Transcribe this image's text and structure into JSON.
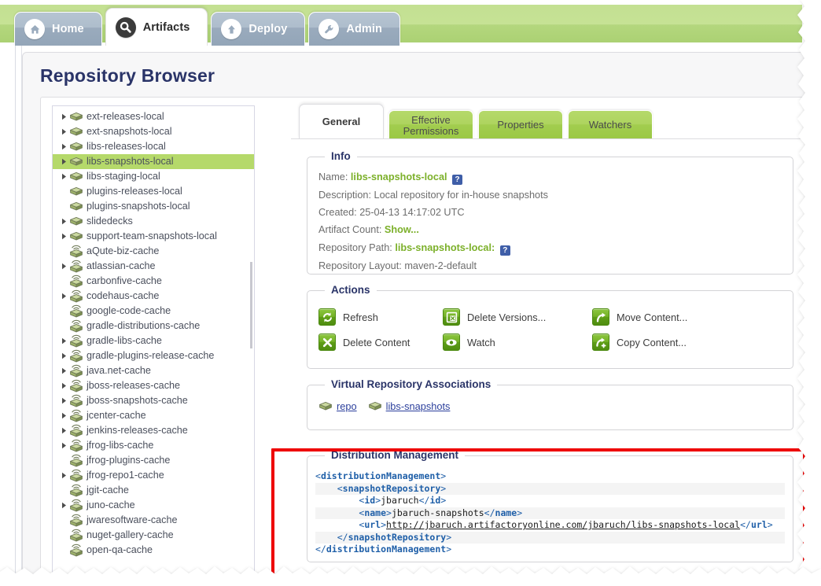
{
  "app": {
    "title": "Repository Browser"
  },
  "nav": {
    "tabs": [
      {
        "label": "Home",
        "icon": "home-icon",
        "active": false
      },
      {
        "label": "Artifacts",
        "icon": "search-icon",
        "active": true
      },
      {
        "label": "Deploy",
        "icon": "upload-arrow-icon",
        "active": false
      },
      {
        "label": "Admin",
        "icon": "wrench-icon",
        "active": false
      }
    ]
  },
  "tree": {
    "selected": "libs-snapshots-local",
    "items": [
      {
        "label": "ext-releases-local",
        "type": "local",
        "expandable": true
      },
      {
        "label": "ext-snapshots-local",
        "type": "local",
        "expandable": true
      },
      {
        "label": "libs-releases-local",
        "type": "local",
        "expandable": true
      },
      {
        "label": "libs-snapshots-local",
        "type": "local",
        "expandable": true
      },
      {
        "label": "libs-staging-local",
        "type": "local",
        "expandable": true
      },
      {
        "label": "plugins-releases-local",
        "type": "local",
        "expandable": false
      },
      {
        "label": "plugins-snapshots-local",
        "type": "local",
        "expandable": false
      },
      {
        "label": "slidedecks",
        "type": "local",
        "expandable": true
      },
      {
        "label": "support-team-snapshots-local",
        "type": "local",
        "expandable": true
      },
      {
        "label": "aQute-biz-cache",
        "type": "cache",
        "expandable": false
      },
      {
        "label": "atlassian-cache",
        "type": "cache",
        "expandable": true
      },
      {
        "label": "carbonfive-cache",
        "type": "cache",
        "expandable": false
      },
      {
        "label": "codehaus-cache",
        "type": "cache",
        "expandable": true
      },
      {
        "label": "google-code-cache",
        "type": "cache",
        "expandable": false
      },
      {
        "label": "gradle-distributions-cache",
        "type": "cache",
        "expandable": false
      },
      {
        "label": "gradle-libs-cache",
        "type": "cache",
        "expandable": true
      },
      {
        "label": "gradle-plugins-release-cache",
        "type": "cache",
        "expandable": true
      },
      {
        "label": "java.net-cache",
        "type": "cache",
        "expandable": true
      },
      {
        "label": "jboss-releases-cache",
        "type": "cache",
        "expandable": true
      },
      {
        "label": "jboss-snapshots-cache",
        "type": "cache",
        "expandable": true
      },
      {
        "label": "jcenter-cache",
        "type": "cache",
        "expandable": true
      },
      {
        "label": "jenkins-releases-cache",
        "type": "cache",
        "expandable": true
      },
      {
        "label": "jfrog-libs-cache",
        "type": "cache",
        "expandable": true
      },
      {
        "label": "jfrog-plugins-cache",
        "type": "cache",
        "expandable": false
      },
      {
        "label": "jfrog-repo1-cache",
        "type": "cache",
        "expandable": true
      },
      {
        "label": "jgit-cache",
        "type": "cache",
        "expandable": false
      },
      {
        "label": "juno-cache",
        "type": "cache",
        "expandable": true
      },
      {
        "label": "jwaresoftware-cache",
        "type": "cache",
        "expandable": false
      },
      {
        "label": "nuget-gallery-cache",
        "type": "cache",
        "expandable": false
      },
      {
        "label": "open-qa-cache",
        "type": "cache",
        "expandable": false
      }
    ]
  },
  "detail": {
    "tabs": [
      {
        "label": "General",
        "active": true
      },
      {
        "label": "Effective\nPermissions",
        "active": false
      },
      {
        "label": "Properties",
        "active": false
      },
      {
        "label": "Watchers",
        "active": false
      }
    ],
    "info": {
      "legend": "Info",
      "name_label": "Name:",
      "name_value": "libs-snapshots-local",
      "description_label": "Description:",
      "description_value": "Local repository for in-house snapshots",
      "created_label": "Created:",
      "created_value": "25-04-13 14:17:02 UTC",
      "artifact_count_label": "Artifact Count:",
      "artifact_count_value": "Show...",
      "repository_path_label": "Repository Path:",
      "repository_path_value": "libs-snapshots-local:",
      "repository_layout_label": "Repository Layout:",
      "repository_layout_value": "maven-2-default",
      "help_glyph": "?"
    },
    "actions": {
      "legend": "Actions",
      "items": [
        {
          "label": "Refresh",
          "icon": "refresh-icon"
        },
        {
          "label": "Delete Versions...",
          "icon": "delete-versions-icon"
        },
        {
          "label": "Move Content...",
          "icon": "move-content-icon"
        },
        {
          "label": "Delete Content",
          "icon": "delete-content-icon"
        },
        {
          "label": "Watch",
          "icon": "eye-icon"
        },
        {
          "label": "Copy Content...",
          "icon": "copy-content-icon"
        }
      ]
    },
    "virtual": {
      "legend": "Virtual Repository Associations",
      "links": [
        "repo",
        "libs-snapshots"
      ]
    },
    "distribution": {
      "legend": "Distribution Management",
      "lines": [
        {
          "indent": 0,
          "parts": [
            {
              "t": "ang",
              "v": "<"
            },
            {
              "t": "tag",
              "v": "distributionManagement"
            },
            {
              "t": "ang",
              "v": ">"
            }
          ]
        },
        {
          "indent": 1,
          "parts": [
            {
              "t": "ang",
              "v": "<"
            },
            {
              "t": "tag",
              "v": "snapshotRepository"
            },
            {
              "t": "ang",
              "v": ">"
            }
          ]
        },
        {
          "indent": 2,
          "parts": [
            {
              "t": "ang",
              "v": "<"
            },
            {
              "t": "tag",
              "v": "id"
            },
            {
              "t": "ang",
              "v": ">"
            },
            {
              "t": "txt",
              "v": "jbaruch"
            },
            {
              "t": "ang",
              "v": "</"
            },
            {
              "t": "tag",
              "v": "id"
            },
            {
              "t": "ang",
              "v": ">"
            }
          ]
        },
        {
          "indent": 2,
          "parts": [
            {
              "t": "ang",
              "v": "<"
            },
            {
              "t": "tag",
              "v": "name"
            },
            {
              "t": "ang",
              "v": ">"
            },
            {
              "t": "txt",
              "v": "jbaruch-snapshots"
            },
            {
              "t": "ang",
              "v": "</"
            },
            {
              "t": "tag",
              "v": "name"
            },
            {
              "t": "ang",
              "v": ">"
            }
          ]
        },
        {
          "indent": 2,
          "parts": [
            {
              "t": "ang",
              "v": "<"
            },
            {
              "t": "tag",
              "v": "url"
            },
            {
              "t": "ang",
              "v": ">"
            },
            {
              "t": "url",
              "v": "http://jbaruch.artifactoryonline.com/jbaruch/libs-snapshots-local"
            },
            {
              "t": "ang",
              "v": "</"
            },
            {
              "t": "tag",
              "v": "url"
            },
            {
              "t": "ang",
              "v": ">"
            }
          ]
        },
        {
          "indent": 1,
          "parts": [
            {
              "t": "ang",
              "v": "</"
            },
            {
              "t": "tag",
              "v": "snapshotRepository"
            },
            {
              "t": "ang",
              "v": ">"
            }
          ]
        },
        {
          "indent": 0,
          "parts": [
            {
              "t": "ang",
              "v": "</"
            },
            {
              "t": "tag",
              "v": "distributionManagement"
            },
            {
              "t": "ang",
              "v": ">"
            }
          ]
        }
      ]
    }
  },
  "annotation": {
    "highlight_color": "#ee0000",
    "target": "Distribution Management"
  },
  "colors": {
    "brand_green": "#b5d96a",
    "header_green": "#c6e295",
    "title_navy": "#2a3468",
    "link_blue": "#2b3f9c",
    "value_green": "#7cb02a",
    "tab_blue_gray": "#9aabbd"
  }
}
